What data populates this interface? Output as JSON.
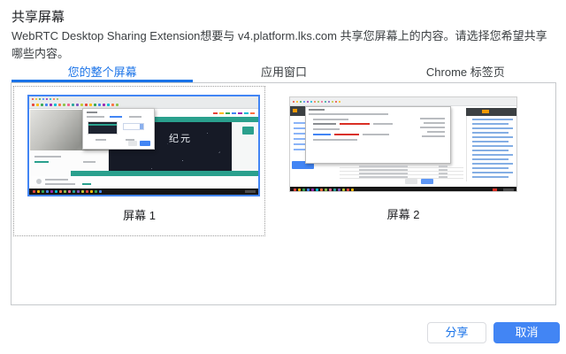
{
  "dialog": {
    "title": "共享屏幕",
    "description": "WebRTC Desktop Sharing Extension想要与 v4.platform.lks.com 共享您屏幕上的内容。请选择您希望共享哪些内容。"
  },
  "tabs": [
    {
      "label": "您的整个屏幕",
      "active": true
    },
    {
      "label": "应用窗口",
      "active": false
    },
    {
      "label": "Chrome 标签页",
      "active": false
    }
  ],
  "screens": [
    {
      "label": "屏幕 1",
      "selected": true,
      "overlay_text": "纪元"
    },
    {
      "label": "屏幕 2",
      "selected": false
    }
  ],
  "buttons": {
    "share": "分享",
    "cancel": "取消"
  },
  "colors": {
    "accent": "#1a73e8",
    "primary-btn": "#4285f4",
    "selected-border": "#4285f4",
    "teal": "#2aa08d",
    "dark-screen": "#161a26",
    "taskbar": "#161616",
    "border": "#c6c9cc",
    "text": "#202124",
    "muted": "#3c4043",
    "icon_palette": [
      "#e8453c",
      "#fbbc05",
      "#34a853",
      "#4285f4",
      "#9c27b0",
      "#00bcd4",
      "#ff7043",
      "#8bc34a",
      "#f06292",
      "#26a69a",
      "#7e57c2",
      "#c0ca33"
    ]
  }
}
